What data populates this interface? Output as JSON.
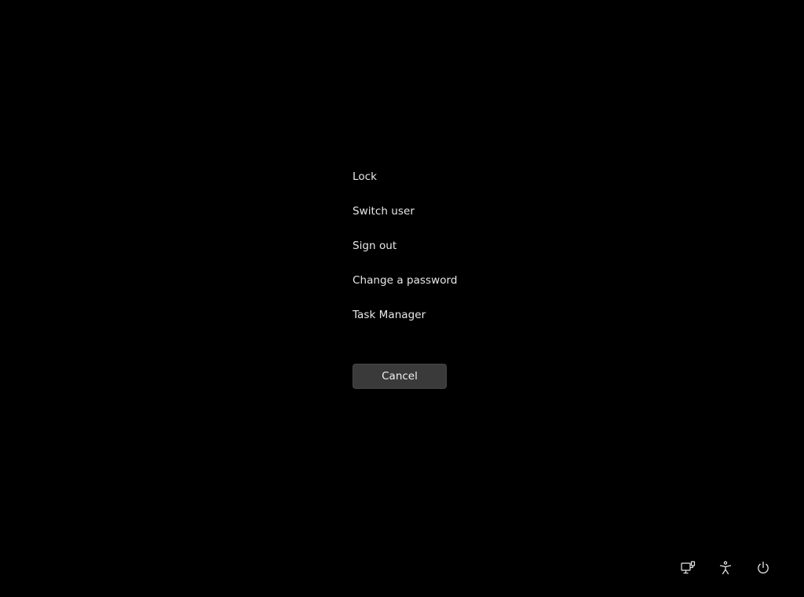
{
  "menu": {
    "items": [
      {
        "label": "Lock"
      },
      {
        "label": "Switch user"
      },
      {
        "label": "Sign out"
      },
      {
        "label": "Change a password"
      },
      {
        "label": "Task Manager"
      }
    ]
  },
  "cancel_label": "Cancel",
  "tray": {
    "icons": [
      "network-icon",
      "accessibility-icon",
      "power-icon"
    ]
  },
  "colors": {
    "background": "#000000",
    "text": "#e8e8e8",
    "button_bg": "#3a3a3a"
  }
}
